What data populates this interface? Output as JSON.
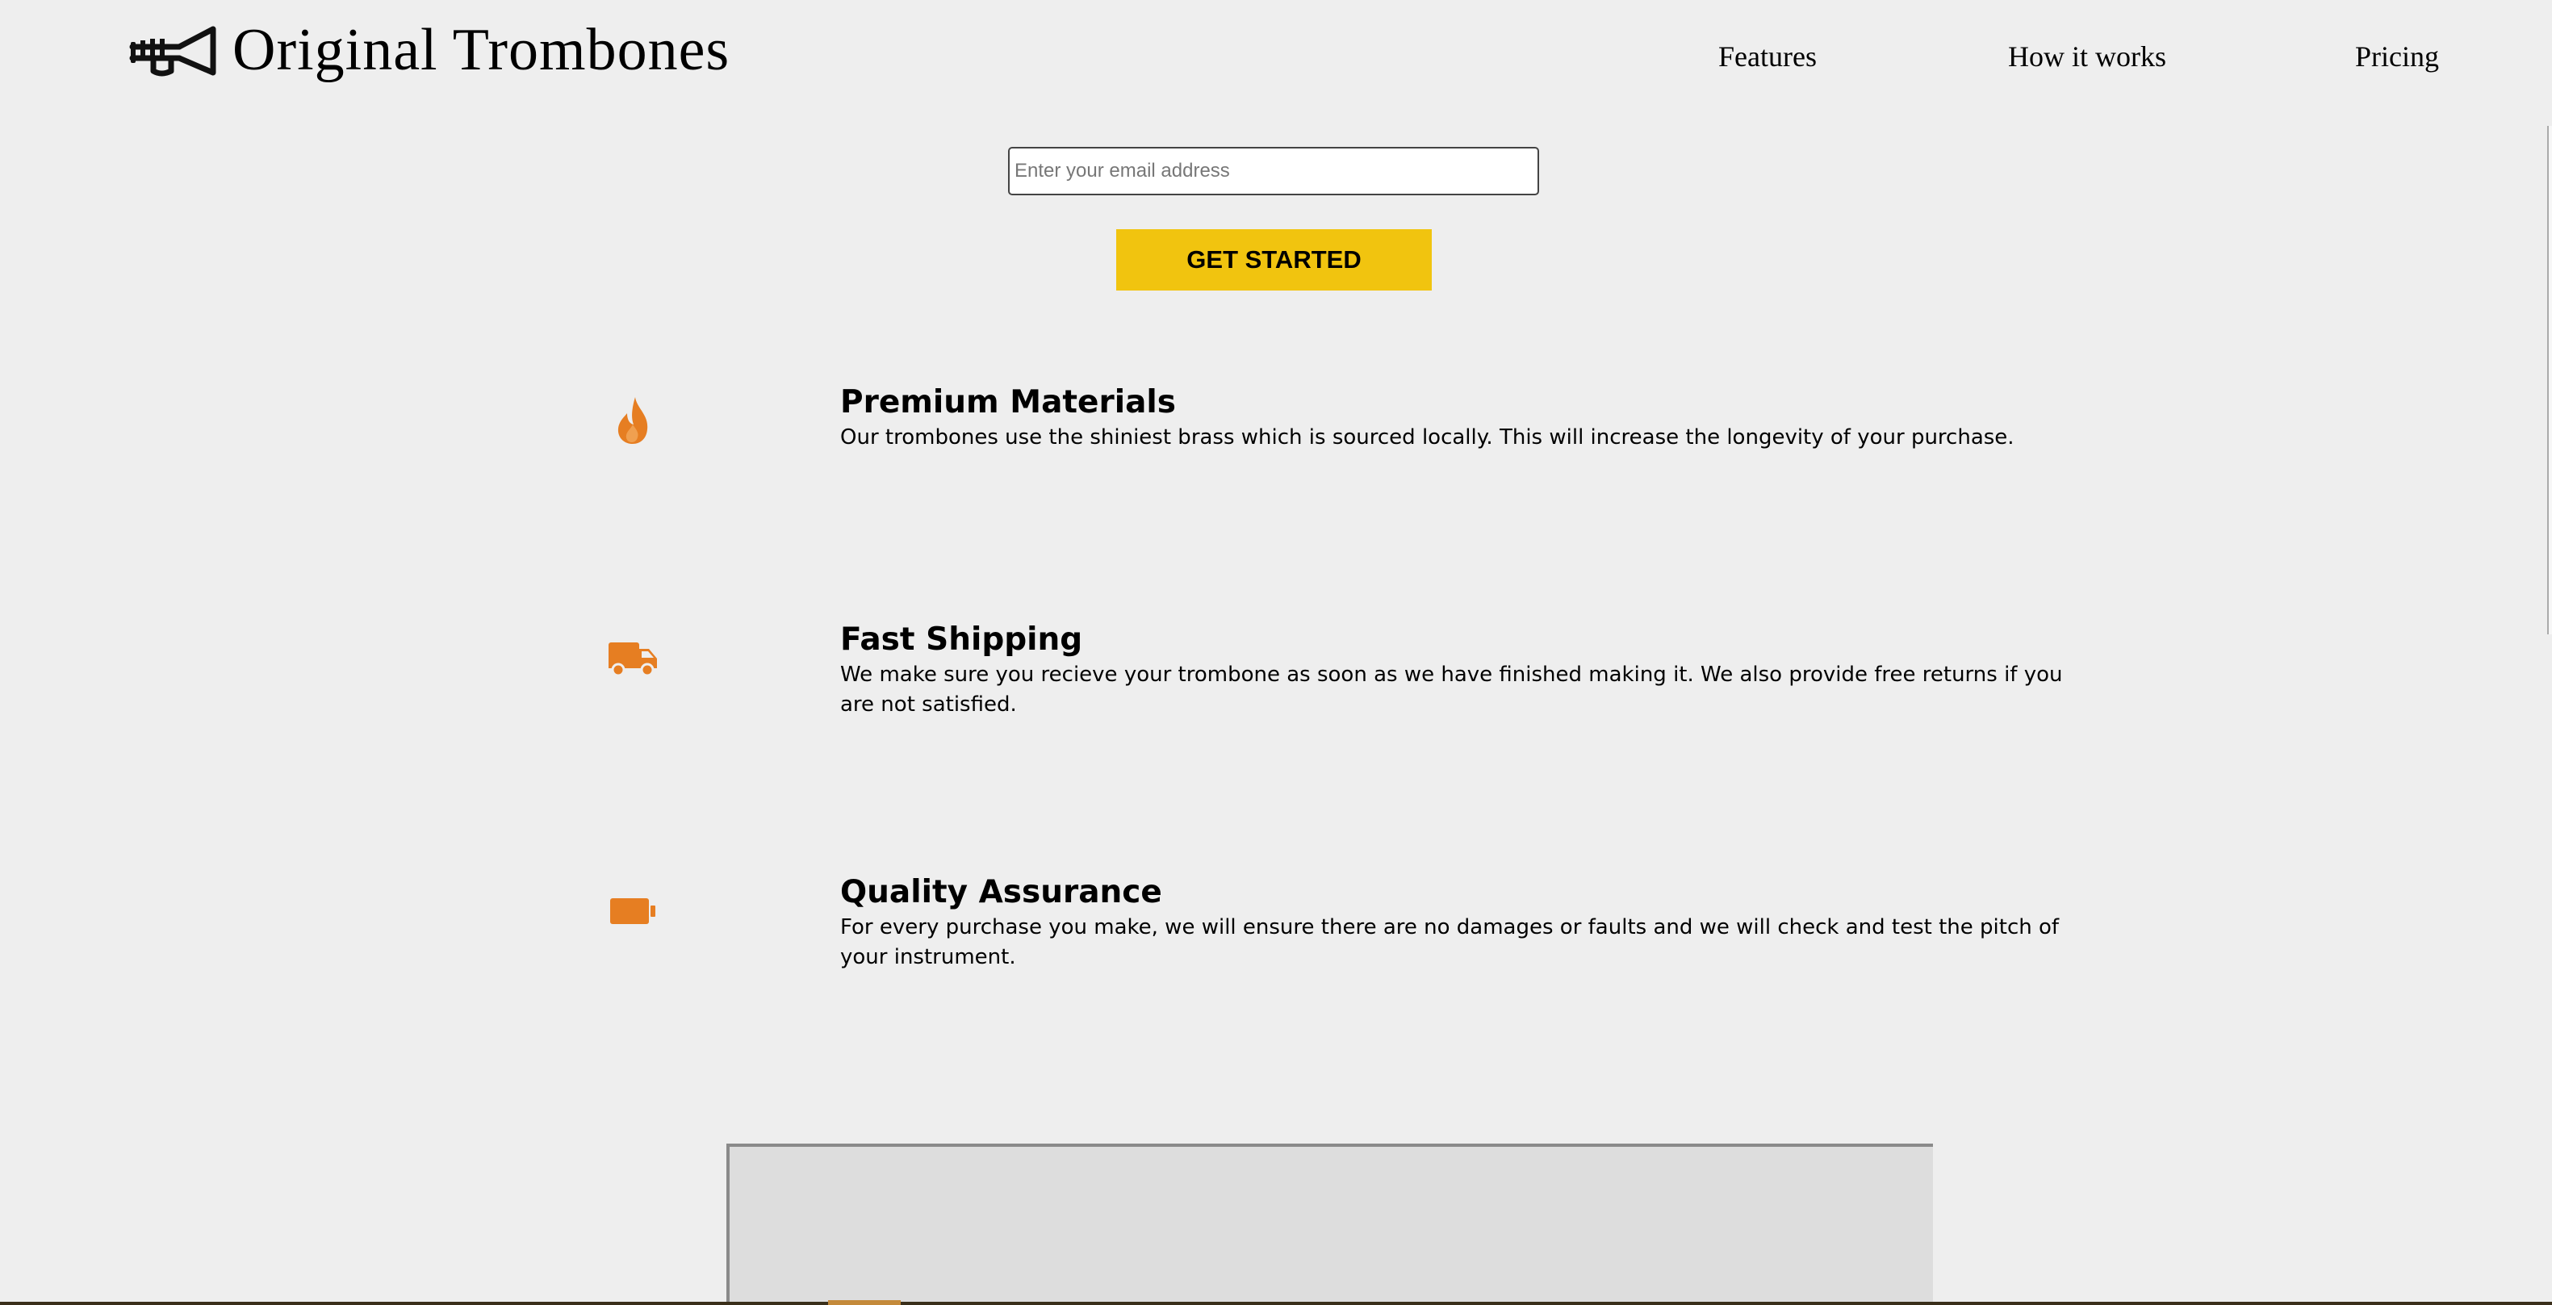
{
  "header": {
    "brand": "Original Trombones",
    "logo_icon": "trumpet-logo-icon",
    "nav": [
      {
        "label": "Features"
      },
      {
        "label": "How it works"
      },
      {
        "label": "Pricing"
      }
    ]
  },
  "form": {
    "email_placeholder": "Enter your email address",
    "email_value": "",
    "submit_label": "GET STARTED"
  },
  "features": [
    {
      "icon": "fire-icon",
      "title": "Premium Materials",
      "description": "Our trombones use the shiniest brass which is sourced locally. This will increase the longevity of your purchase."
    },
    {
      "icon": "truck-icon",
      "title": "Fast Shipping",
      "description": "We make sure you recieve your trombone as soon as we have finished making it. We also provide free returns if you are not satisfied."
    },
    {
      "icon": "battery-icon",
      "title": "Quality Assurance",
      "description": "For every purchase you make, we will ensure there are no damages or faults and we will check and test the pitch of your instrument."
    }
  ],
  "colors": {
    "background": "#eeeeee",
    "accent": "#f1c40f",
    "icon": "#e67e22"
  }
}
